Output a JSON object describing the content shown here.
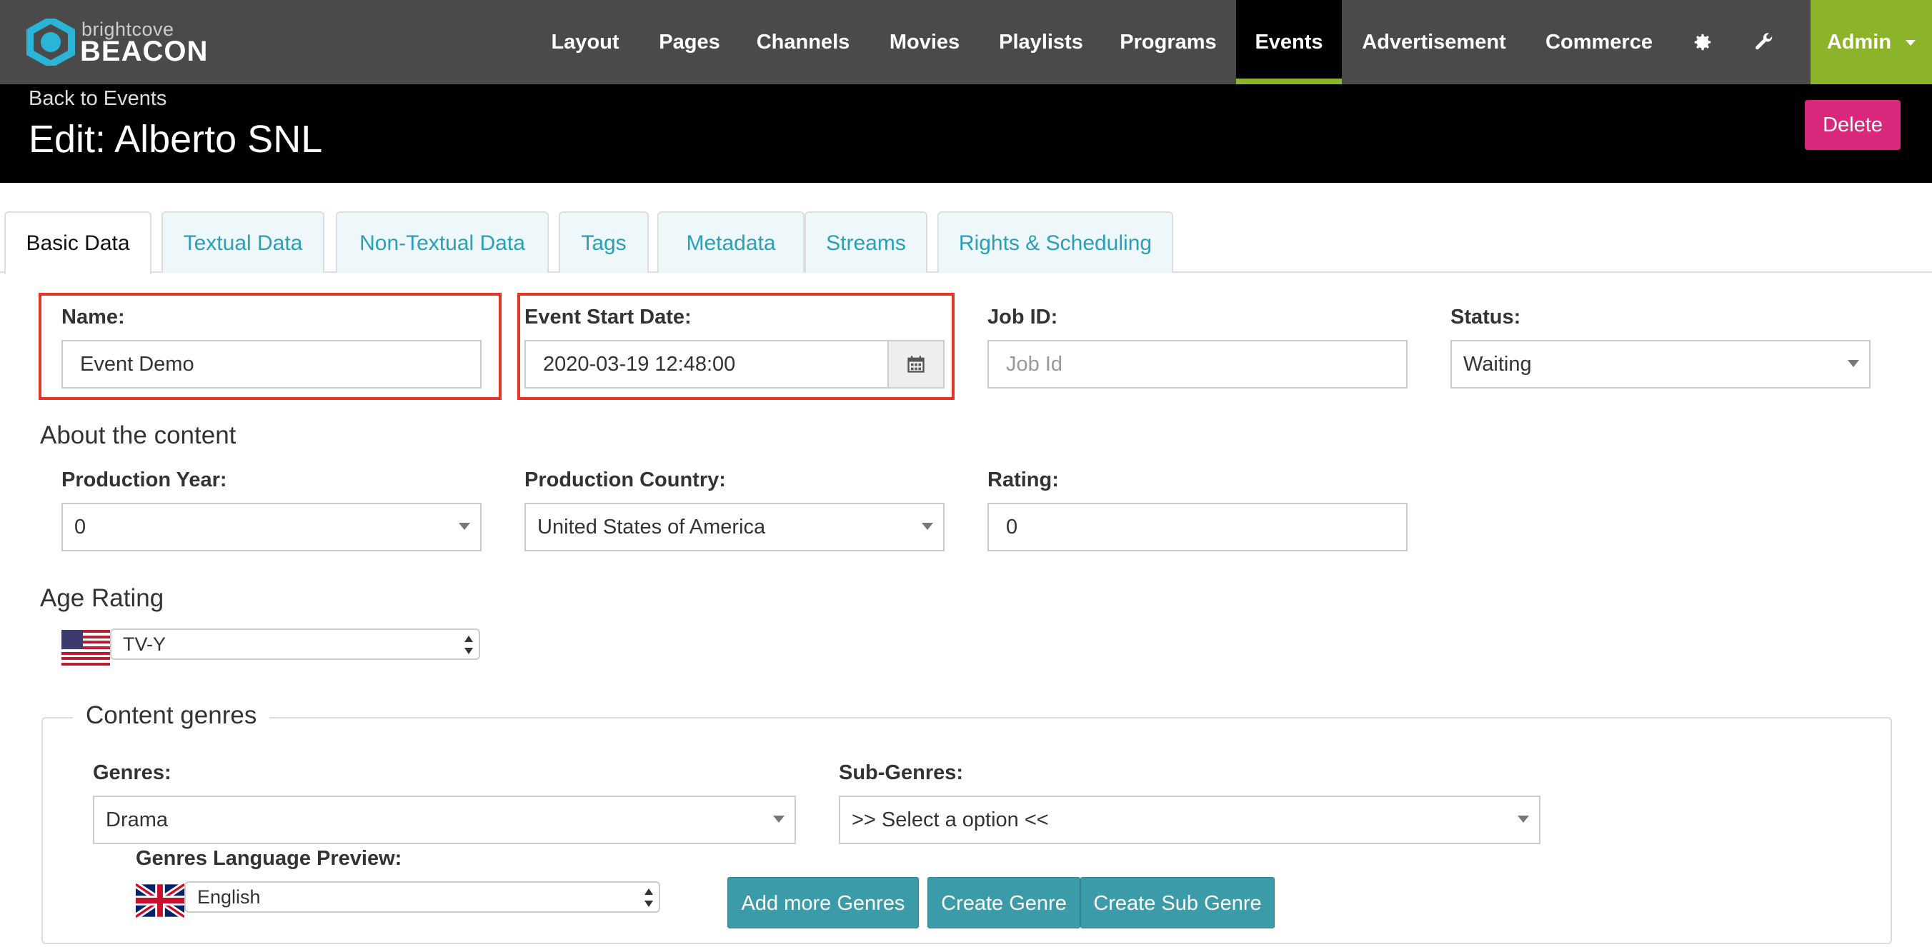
{
  "brand": {
    "small": "brightcove",
    "big": "BEACON"
  },
  "nav": {
    "items": [
      {
        "label": "Layout"
      },
      {
        "label": "Pages"
      },
      {
        "label": "Channels"
      },
      {
        "label": "Movies"
      },
      {
        "label": "Playlists"
      },
      {
        "label": "Programs"
      },
      {
        "label": "Events"
      },
      {
        "label": "Advertisement"
      },
      {
        "label": "Commerce"
      }
    ],
    "active": "Events",
    "settings_icon": "gear-icon",
    "tools_icon": "wrench-icon",
    "admin_label": "Admin",
    "accent_color": "#8cb42a"
  },
  "header": {
    "back_label": "Back to Events",
    "title": "Edit: Alberto SNL",
    "delete_label": "Delete",
    "delete_color": "#d9297c"
  },
  "tabs": [
    {
      "label": "Basic Data"
    },
    {
      "label": "Textual Data"
    },
    {
      "label": "Non-Textual Data"
    },
    {
      "label": "Tags"
    },
    {
      "label": "Metadata"
    },
    {
      "label": "Streams"
    },
    {
      "label": "Rights & Scheduling"
    }
  ],
  "form": {
    "name_label": "Name:",
    "name_value": "Event Demo",
    "start_date_label": "Event Start Date:",
    "start_date_value": "2020-03-19 12:48:00",
    "job_id_label": "Job ID:",
    "job_id_placeholder": "Job Id",
    "status_label": "Status:",
    "status_value": "Waiting",
    "about_title": "About the content",
    "production_year_label": "Production Year:",
    "production_year_value": "0",
    "production_country_label": "Production Country:",
    "production_country_value": "United States of America",
    "rating_label": "Rating:",
    "rating_value": "0",
    "age_rating_title": "Age Rating",
    "age_rating_value": "TV-Y",
    "genres_legend": "Content genres",
    "genres_label": "Genres:",
    "genres_value": "Drama",
    "subgenres_label": "Sub-Genres:",
    "subgenres_value": ">> Select a option <<",
    "genres_lang_label": "Genres Language Preview:",
    "genres_lang_value": "English",
    "add_genres_label": "Add more Genres",
    "create_genre_label": "Create Genre",
    "create_subgenre_label": "Create Sub Genre"
  }
}
